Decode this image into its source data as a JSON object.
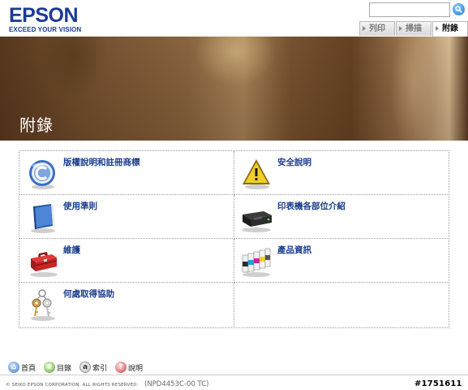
{
  "brand": {
    "logo_text": "EPSON",
    "tagline": "EXCEED YOUR VISION"
  },
  "search": {
    "placeholder": "",
    "icon": "search-icon"
  },
  "tabs": [
    {
      "label": "列印",
      "active": false
    },
    {
      "label": "掃描",
      "active": false
    },
    {
      "label": "附錄",
      "active": true
    }
  ],
  "banner": {
    "title": "附錄"
  },
  "sections": [
    {
      "label": "版權說明和註冊商標",
      "icon": "copyright-icon"
    },
    {
      "label": "安全說明",
      "icon": "warning-icon"
    },
    {
      "label": "使用準則",
      "icon": "manual-book-icon"
    },
    {
      "label": "印表機各部位介紹",
      "icon": "printer-icon"
    },
    {
      "label": "維護",
      "icon": "toolbox-icon"
    },
    {
      "label": "產品資訊",
      "icon": "ink-cartridges-icon"
    },
    {
      "label": "何處取得協助",
      "icon": "keys-icon"
    }
  ],
  "footer_nav": [
    {
      "label": "首頁",
      "icon": "home-icon",
      "glyph": "⌂"
    },
    {
      "label": "目錄",
      "icon": "contents-icon",
      "glyph": "≡"
    },
    {
      "label": "索引",
      "icon": "index-icon",
      "glyph": "a"
    },
    {
      "label": "說明",
      "icon": "help-icon",
      "glyph": "?"
    }
  ],
  "footer": {
    "copyright": "© SEIKO EPSON CORPORATION. ALL RIGHTS RESERVED.",
    "doc_code": "(NPD4453C-00 TC)"
  },
  "watermark": "#1751611",
  "colors": {
    "brand_blue": "#1b3a94",
    "link_blue": "#1a3c8c"
  }
}
